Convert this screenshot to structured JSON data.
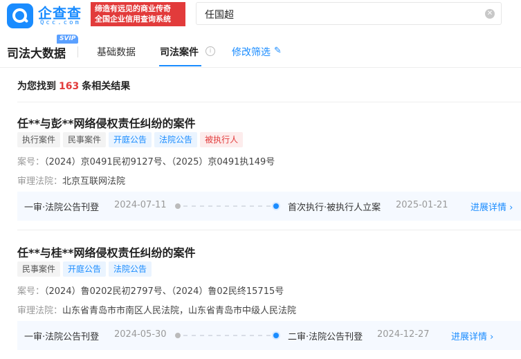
{
  "header": {
    "logo_name": "企查查",
    "logo_sub": "Qcc.com",
    "promo_line1": "缔造有远见的商业传奇",
    "promo_line2": "全国企业信用查询系统",
    "search_value": "任国超"
  },
  "nav": {
    "brand_title": "司法大数据",
    "brand_badge": "SVIP",
    "tabs": [
      "基础数据",
      "司法案件"
    ],
    "edit_label": "修改筛选"
  },
  "results": {
    "prefix": "为您找到",
    "count": "163",
    "suffix": "条相关结果"
  },
  "cases": [
    {
      "title": "任**与彭**网络侵权责任纠纷的案件",
      "tags": [
        {
          "label": "执行案件",
          "color": "gray"
        },
        {
          "label": "民事案件",
          "color": "gray"
        },
        {
          "label": "开庭公告",
          "color": "blue"
        },
        {
          "label": "法院公告",
          "color": "blue"
        },
        {
          "label": "被执行人",
          "color": "red"
        }
      ],
      "case_no_label": "案号：",
      "case_no": "（2024）京0491民初9127号、（2025）京0491执149号",
      "court_label": "审理法院：",
      "court": "北京互联网法院",
      "timeline": {
        "start_label": "一审·法院公告刊登",
        "start_date": "2024-07-11",
        "end_label": "首次执行·被执行人立案",
        "end_date": "2025-01-21",
        "more": "进展详情"
      }
    },
    {
      "title": "任**与桂**网络侵权责任纠纷的案件",
      "tags": [
        {
          "label": "民事案件",
          "color": "gray"
        },
        {
          "label": "开庭公告",
          "color": "blue"
        },
        {
          "label": "法院公告",
          "color": "blue"
        }
      ],
      "case_no_label": "案号：",
      "case_no": "（2024）鲁0202民初2797号、（2024）鲁02民终15715号",
      "court_label": "审理法院：",
      "court": "山东省青岛市市南区人民法院，山东省青岛市中级人民法院",
      "timeline": {
        "start_label": "一审·法院公告刊登",
        "start_date": "2024-05-30",
        "end_label": "二审·法院公告刊登",
        "end_date": "2024-12-27",
        "more": "进展详情"
      }
    }
  ],
  "colors": {
    "brand_blue": "#1a8cff",
    "accent_red": "#e23b3b"
  }
}
